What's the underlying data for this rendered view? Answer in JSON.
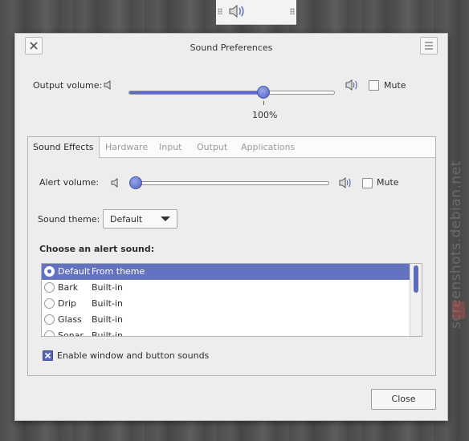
{
  "panel": {
    "speaker_icon": "speaker-icon"
  },
  "watermark": {
    "text": "screenshots.debian.net"
  },
  "dialog": {
    "title": "Sound Preferences",
    "close_icon": "close-icon",
    "menu_icon": "hamburger-menu-icon"
  },
  "output": {
    "label": "Output volume:",
    "value_text": "100%",
    "level": 1.0,
    "mute_label": "Mute",
    "mute_checked": false
  },
  "tabs": [
    "Sound Effects",
    "Hardware",
    "Input",
    "Output",
    "Applications"
  ],
  "active_tab": "Sound Effects",
  "alert": {
    "label": "Alert volume:",
    "level": 0.0,
    "mute_label": "Mute",
    "mute_checked": false
  },
  "theme": {
    "label": "Sound theme:",
    "selected": "Default"
  },
  "alert_sound": {
    "heading": "Choose an alert sound:",
    "items": [
      {
        "name": "Default",
        "source": "From theme",
        "selected": true
      },
      {
        "name": "Bark",
        "source": "Built-in",
        "selected": false
      },
      {
        "name": "Drip",
        "source": "Built-in",
        "selected": false
      },
      {
        "name": "Glass",
        "source": "Built-in",
        "selected": false
      },
      {
        "name": "Sonar",
        "source": "Built-in",
        "selected": false
      }
    ]
  },
  "window_sounds": {
    "label": "Enable window and button sounds",
    "checked": true
  },
  "close_button": {
    "label": "Close"
  },
  "colors": {
    "accent": "#6373c2",
    "window_bg": "#ededed",
    "desktop_bg": "#555555"
  }
}
